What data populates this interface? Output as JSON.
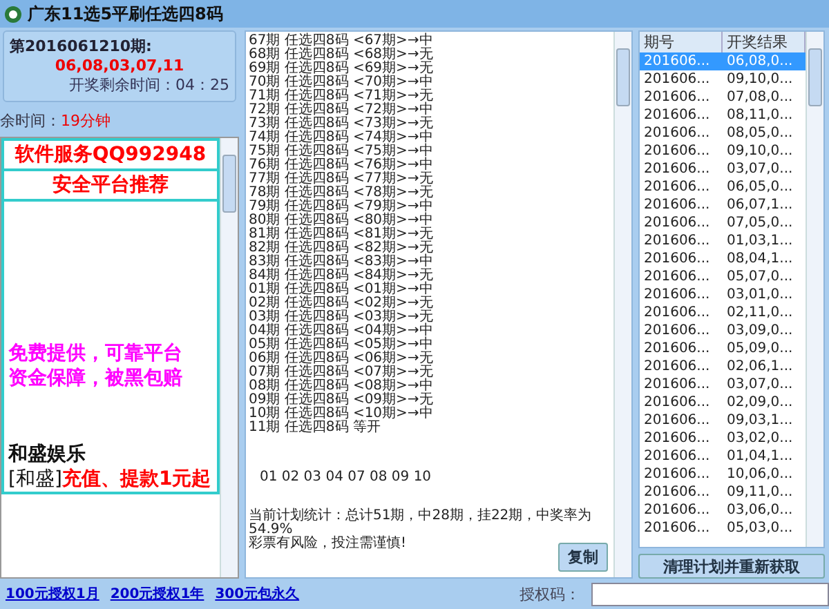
{
  "window": {
    "title": "广东11选5平刷任选四8码"
  },
  "draw": {
    "issue": "第2016061210期:",
    "numbers": "06,08,03,07,11",
    "countdown": "开奖剩余时间：04：25"
  },
  "remaining": {
    "label": "余时间：",
    "value": "19分钟"
  },
  "ads": [
    {
      "kind": "headline",
      "text": "软件服务QQ992948"
    },
    {
      "kind": "headline",
      "text": "安全平台推荐"
    },
    {
      "kind": "promo",
      "text": "免费提供，可靠平台"
    },
    {
      "kind": "promo",
      "text": "资金保障，被黑包赔"
    },
    {
      "kind": "brand",
      "text": "和盛娱乐"
    },
    {
      "kind": "offer",
      "prefix": "[和盛]",
      "text": "充值、提款1元起"
    }
  ],
  "plan_lines": [
    "67期 任选四8码 <67期>→中",
    "68期 任选四8码 <68期>→无",
    "69期 任选四8码 <69期>→无",
    "70期 任选四8码 <70期>→中",
    "71期 任选四8码 <71期>→无",
    "72期 任选四8码 <72期>→中",
    "73期 任选四8码 <73期>→无",
    "74期 任选四8码 <74期>→中",
    "75期 任选四8码 <75期>→中",
    "76期 任选四8码 <76期>→中",
    "77期 任选四8码 <77期>→无",
    "78期 任选四8码 <78期>→无",
    "79期 任选四8码 <79期>→中",
    "80期 任选四8码 <80期>→中",
    "81期 任选四8码 <81期>→无",
    "82期 任选四8码 <82期>→无",
    "83期 任选四8码 <83期>→中",
    "84期 任选四8码 <84期>→无",
    "01期 任选四8码 <01期>→中",
    "02期 任选四8码 <02期>→无",
    "03期 任选四8码 <03期>→无",
    "04期 任选四8码 <04期>→中",
    "05期 任选四8码 <05期>→中",
    "06期 任选四8码 <06期>→无",
    "07期 任选四8码 <07期>→无",
    "08期 任选四8码 <08期>→中",
    "09期 任选四8码 <09期>→无",
    "10期 任选四8码 <10期>→中",
    "11期 任选四8码 等开"
  ],
  "plan_numbers": "01 02 03 04 07 08 09 10",
  "stats": [
    "当前计划统计：总计51期，中28期，挂22期，中奖率为54.9%",
    "彩票有风险，投注需谨慎!"
  ],
  "copy_button": "复制",
  "results": {
    "columns": [
      "期号",
      "开奖结果"
    ],
    "rows": [
      {
        "issue": "201606...",
        "result": "06,08,0...",
        "selected": true
      },
      {
        "issue": "201606...",
        "result": "09,10,0...",
        "selected": false
      },
      {
        "issue": "201606...",
        "result": "07,08,0...",
        "selected": false
      },
      {
        "issue": "201606...",
        "result": "08,11,0...",
        "selected": false
      },
      {
        "issue": "201606...",
        "result": "08,05,0...",
        "selected": false
      },
      {
        "issue": "201606...",
        "result": "09,10,0...",
        "selected": false
      },
      {
        "issue": "201606...",
        "result": "03,07,0...",
        "selected": false
      },
      {
        "issue": "201606...",
        "result": "06,05,0...",
        "selected": false
      },
      {
        "issue": "201606...",
        "result": "06,07,1...",
        "selected": false
      },
      {
        "issue": "201606...",
        "result": "07,05,0...",
        "selected": false
      },
      {
        "issue": "201606...",
        "result": "01,03,1...",
        "selected": false
      },
      {
        "issue": "201606...",
        "result": "08,04,1...",
        "selected": false
      },
      {
        "issue": "201606...",
        "result": "05,07,0...",
        "selected": false
      },
      {
        "issue": "201606...",
        "result": "03,01,0...",
        "selected": false
      },
      {
        "issue": "201606...",
        "result": "02,11,0...",
        "selected": false
      },
      {
        "issue": "201606...",
        "result": "03,09,0...",
        "selected": false
      },
      {
        "issue": "201606...",
        "result": "05,09,0...",
        "selected": false
      },
      {
        "issue": "201606...",
        "result": "02,06,1...",
        "selected": false
      },
      {
        "issue": "201606...",
        "result": "03,07,0...",
        "selected": false
      },
      {
        "issue": "201606...",
        "result": "02,09,0...",
        "selected": false
      },
      {
        "issue": "201606...",
        "result": "09,03,1...",
        "selected": false
      },
      {
        "issue": "201606...",
        "result": "03,02,0...",
        "selected": false
      },
      {
        "issue": "201606...",
        "result": "01,04,1...",
        "selected": false
      },
      {
        "issue": "201606...",
        "result": "10,06,0...",
        "selected": false
      },
      {
        "issue": "201606...",
        "result": "09,11,0...",
        "selected": false
      },
      {
        "issue": "201606...",
        "result": "03,06,0...",
        "selected": false
      },
      {
        "issue": "201606...",
        "result": "05,03,0...",
        "selected": false
      }
    ]
  },
  "refresh_button": "清理计划并重新获取",
  "footer": {
    "links": [
      "100元授权1月",
      "200元授权1年",
      "300元包永久"
    ],
    "auth_label": "授权码："
  }
}
